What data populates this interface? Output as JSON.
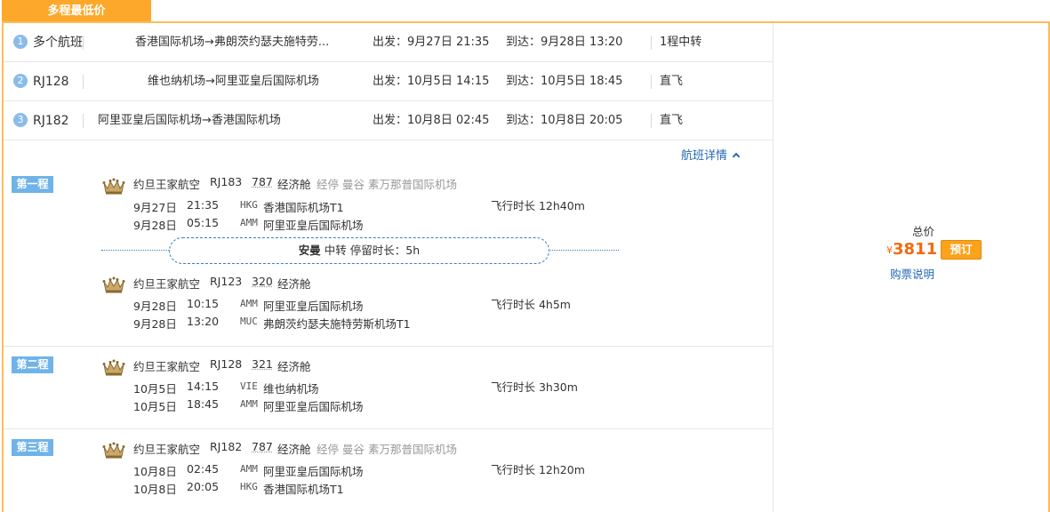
{
  "tab": {
    "label": "多程最低价"
  },
  "summary": [
    {
      "num": "1",
      "code": "多个航班",
      "route": "香港国际机场→弗朗茨约瑟夫施特劳...",
      "dep": "出发：9月27日 21:35",
      "arr": "到达：9月28日 13:20",
      "type": "1程中转"
    },
    {
      "num": "2",
      "code": "RJ128",
      "route": "维也纳机场→阿里亚皇后国际机场",
      "dep": "出发：10月5日 14:15",
      "arr": "到达：10月5日 18:45",
      "type": "直飞"
    },
    {
      "num": "3",
      "code": "RJ182",
      "route": "阿里亚皇后国际机场→香港国际机场",
      "dep": "出发：10月8日 02:45",
      "arr": "到达：10月8日 20:05",
      "type": "直飞"
    }
  ],
  "detail_toggle": "航班详情",
  "legs": [
    {
      "badge": "第一程",
      "flights": [
        {
          "airline": "约旦王家航空",
          "flight": "RJ183",
          "model": "787",
          "cabin": "经济舱",
          "via": "经停 曼谷 素万那普国际机场",
          "dep_date": "9月27日",
          "dep_time": "21:35",
          "dep_code": "HKG",
          "dep_airport": "香港国际机场T1",
          "arr_date": "9月28日",
          "arr_time": "05:15",
          "arr_code": "AMM",
          "arr_airport": "阿里亚皇后国际机场",
          "duration": "飞行时长 12h40m"
        },
        {
          "airline": "约旦王家航空",
          "flight": "RJ123",
          "model": "320",
          "cabin": "经济舱",
          "via": "",
          "dep_date": "9月28日",
          "dep_time": "10:15",
          "dep_code": "AMM",
          "dep_airport": "阿里亚皇后国际机场",
          "arr_date": "9月28日",
          "arr_time": "13:20",
          "arr_code": "MUC",
          "arr_airport": "弗朗茨约瑟夫施特劳斯机场T1",
          "duration": "飞行时长 4h5m"
        }
      ],
      "transfer": {
        "city": "安曼",
        "label": "中转",
        "stay": "停留时长：5h"
      }
    },
    {
      "badge": "第二程",
      "flights": [
        {
          "airline": "约旦王家航空",
          "flight": "RJ128",
          "model": "321",
          "cabin": "经济舱",
          "via": "",
          "dep_date": "10月5日",
          "dep_time": "14:15",
          "dep_code": "VIE",
          "dep_airport": "维也纳机场",
          "arr_date": "10月5日",
          "arr_time": "18:45",
          "arr_code": "AMM",
          "arr_airport": "阿里亚皇后国际机场",
          "duration": "飞行时长 3h30m"
        }
      ]
    },
    {
      "badge": "第三程",
      "flights": [
        {
          "airline": "约旦王家航空",
          "flight": "RJ182",
          "model": "787",
          "cabin": "经济舱",
          "via": "经停 曼谷 素万那普国际机场",
          "dep_date": "10月8日",
          "dep_time": "02:45",
          "dep_code": "AMM",
          "dep_airport": "阿里亚皇后国际机场",
          "arr_date": "10月8日",
          "arr_time": "20:05",
          "arr_code": "HKG",
          "arr_airport": "香港国际机场T1",
          "duration": "飞行时长 12h20m"
        }
      ]
    }
  ],
  "price": {
    "total_label": "总价",
    "currency": "¥",
    "amount": "3811",
    "book_label": "预订",
    "rules_link": "购票说明"
  },
  "colors": {
    "accent": "#fda82a",
    "price": "#f26a0f",
    "link": "#2468b4",
    "badge": "#6fb3e8"
  }
}
